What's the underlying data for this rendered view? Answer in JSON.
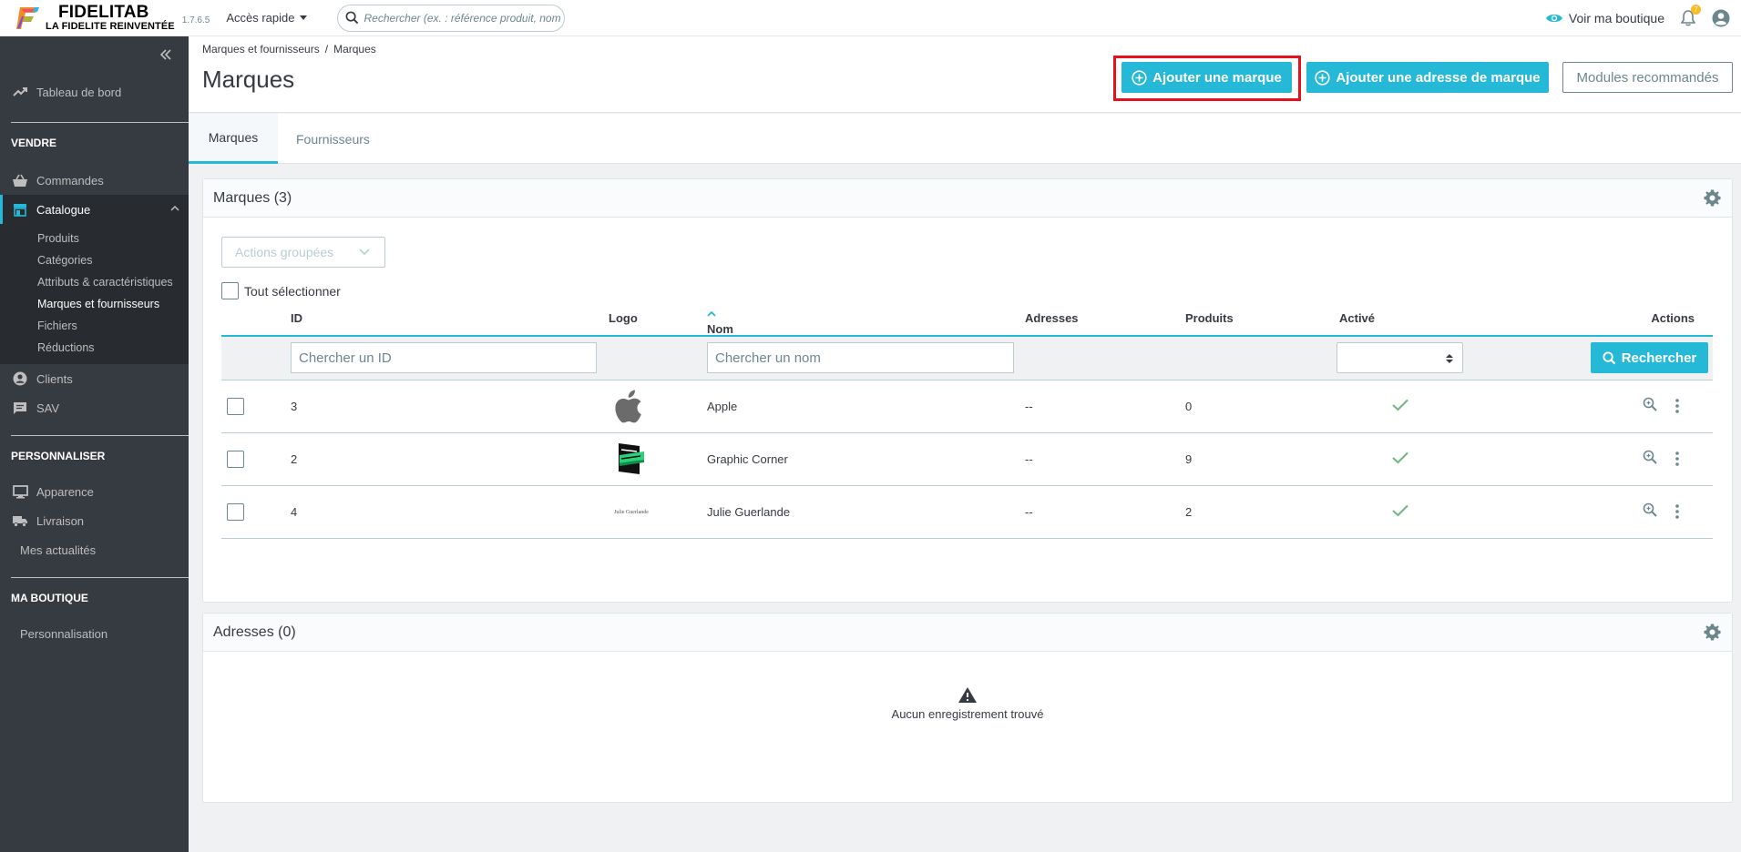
{
  "header": {
    "brand_name": "FIDELITAB",
    "brand_tagline": "LA FIDELITE REINVENTÉE",
    "version": "1.7.6.5",
    "quick_access": "Accès rapide",
    "search_placeholder": "Rechercher (ex. : référence produit, nom",
    "view_shop": "Voir ma boutique",
    "notifications_count": "7"
  },
  "sidebar": {
    "dashboard": "Tableau de bord",
    "section_sell": "VENDRE",
    "orders": "Commandes",
    "catalog": "Catalogue",
    "catalog_items": [
      "Produits",
      "Catégories",
      "Attributs & caractéristiques",
      "Marques et fournisseurs",
      "Fichiers",
      "Réductions"
    ],
    "customers": "Clients",
    "support": "SAV",
    "section_customize": "PERSONNALISER",
    "appearance": "Apparence",
    "shipping": "Livraison",
    "news": "Mes actualités",
    "section_shop": "MA BOUTIQUE",
    "personalization": "Personnalisation"
  },
  "page": {
    "breadcrumb": [
      "Marques et fournisseurs",
      "/",
      "Marques"
    ],
    "title": "Marques",
    "btn_add_brand": "Ajouter une marque",
    "btn_add_brand_address": "Ajouter une adresse de marque",
    "btn_recommended_modules": "Modules recommandés",
    "tabs": [
      "Marques",
      "Fournisseurs"
    ]
  },
  "brands_card": {
    "title": "Marques (3)",
    "bulk_actions": "Actions groupées",
    "select_all": "Tout sélectionner",
    "columns": [
      "ID",
      "Logo",
      "Nom",
      "Adresses",
      "Produits",
      "Activé",
      "Actions"
    ],
    "filter_id_placeholder": "Chercher un ID",
    "filter_name_placeholder": "Chercher un nom",
    "search_button": "Rechercher",
    "rows": [
      {
        "id": "3",
        "logo": "apple-logo",
        "name": "Apple",
        "addresses": "--",
        "products": "0",
        "enabled": true
      },
      {
        "id": "2",
        "logo": "graphic-corner-logo",
        "name": "Graphic Corner",
        "addresses": "--",
        "products": "9",
        "enabled": true
      },
      {
        "id": "4",
        "logo": "julie-guerlande-logo",
        "logo_text": "Julie Guerlande",
        "name": "Julie Guerlande",
        "addresses": "--",
        "products": "2",
        "enabled": true
      }
    ]
  },
  "addresses_card": {
    "title": "Adresses (0)",
    "empty_message": "Aucun enregistrement trouvé"
  },
  "colors": {
    "primary": "#25b9d7",
    "sidebar_bg": "#363a41",
    "highlight": "#e5121e",
    "success": "#70b580"
  }
}
